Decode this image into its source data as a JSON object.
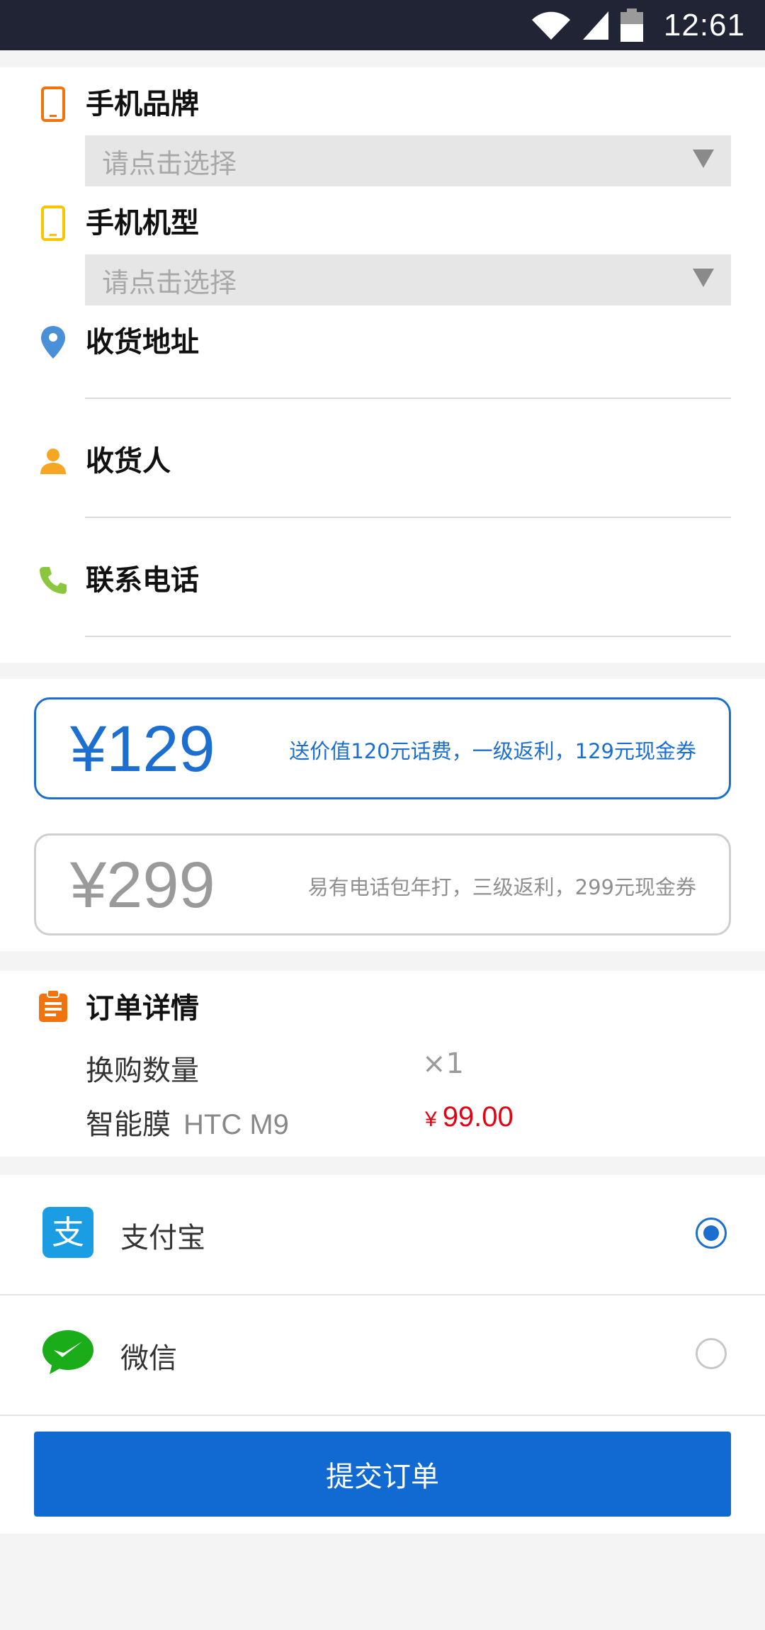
{
  "status_bar": {
    "time": "12:61"
  },
  "form": {
    "brand": {
      "label": "手机品牌",
      "placeholder": "请点击选择"
    },
    "model": {
      "label": "手机机型",
      "placeholder": "请点击选择"
    },
    "address": {
      "label": "收货地址"
    },
    "recipient": {
      "label": "收货人"
    },
    "phone": {
      "label": "联系电话"
    }
  },
  "plans": [
    {
      "price": "¥129",
      "desc": "送价值120元话费，一级返利，129元现金券",
      "selected": true
    },
    {
      "price": "¥299",
      "desc": "易有电话包年打，三级返利，299元现金券",
      "selected": false
    }
  ],
  "order": {
    "title": "订单详情",
    "qty_label": "换购数量",
    "qty_value": "×1",
    "item_label": "智能膜",
    "item_model": "HTC M9",
    "currency": "¥",
    "item_price": "99.00"
  },
  "payment": {
    "alipay_label": "支付宝",
    "wechat_label": "微信",
    "selected": "alipay"
  },
  "submit_label": "提交订单",
  "colors": {
    "accent": "#1c6fd1",
    "status_bar": "#212434",
    "price_red": "#e60012"
  },
  "icons": [
    "wifi-icon",
    "signal-icon",
    "battery-icon",
    "phone-orange-icon",
    "phone-yellow-icon",
    "location-pin-icon",
    "person-icon",
    "telephone-icon",
    "clipboard-icon",
    "alipay-icon",
    "wechat-icon"
  ]
}
